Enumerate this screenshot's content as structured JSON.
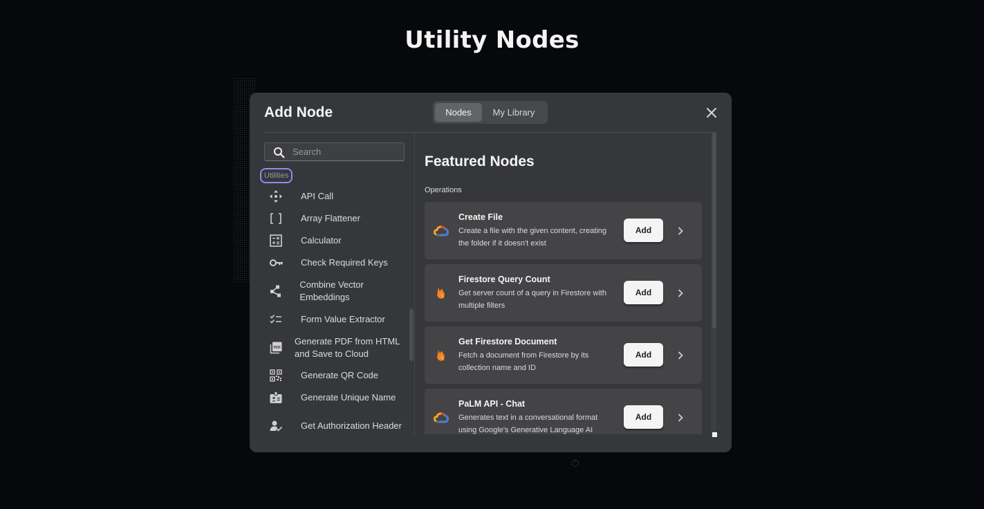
{
  "page": {
    "title": "Utility Nodes"
  },
  "modal": {
    "title": "Add Node",
    "tabs": [
      {
        "label": "Nodes",
        "active": true
      },
      {
        "label": "My Library",
        "active": false
      }
    ],
    "close_icon": "close-icon"
  },
  "sidebar": {
    "search": {
      "placeholder": "Search",
      "value": ""
    },
    "category_chip": "Utilities",
    "items": [
      {
        "label": "API Call",
        "icon": "move-arrows-icon"
      },
      {
        "label": "Array Flattener",
        "icon": "brackets-icon"
      },
      {
        "label": "Calculator",
        "icon": "calculator-icon"
      },
      {
        "label": "Check Required Keys",
        "icon": "key-icon"
      },
      {
        "label": "Combine Vector Embeddings",
        "icon": "share-nodes-icon"
      },
      {
        "label": "Form Value Extractor",
        "icon": "checklist-icon"
      },
      {
        "label": "Generate PDF from HTML and Save to Cloud",
        "icon": "pdf-icon"
      },
      {
        "label": "Generate QR Code",
        "icon": "qr-code-icon"
      },
      {
        "label": "Generate Unique Name",
        "icon": "id-badge-icon"
      },
      {
        "label": "Get Authorization Header",
        "icon": "user-check-icon"
      }
    ]
  },
  "main": {
    "title": "Featured Nodes",
    "section_label": "Operations",
    "add_label": "Add",
    "cards": [
      {
        "title": "Create File",
        "description": "Create a file with the given content, creating the folder if it doesn't exist",
        "icon": "google-cloud-icon"
      },
      {
        "title": "Firestore Query Count",
        "description": "Get server count of a query in Firestore with multiple filters",
        "icon": "firebase-icon"
      },
      {
        "title": "Get Firestore Document",
        "description": "Fetch a document from Firestore by its collection name and ID",
        "icon": "firebase-icon"
      },
      {
        "title": "PaLM API - Chat",
        "description": "Generates text in a conversational format using Google's Generative Language AI",
        "icon": "google-cloud-icon"
      }
    ]
  },
  "colors": {
    "background": "#07080b",
    "modal": "#36373b",
    "card": "#444447",
    "focus_ring": "#8a8ff0",
    "firebase_orange": "#f58220"
  }
}
